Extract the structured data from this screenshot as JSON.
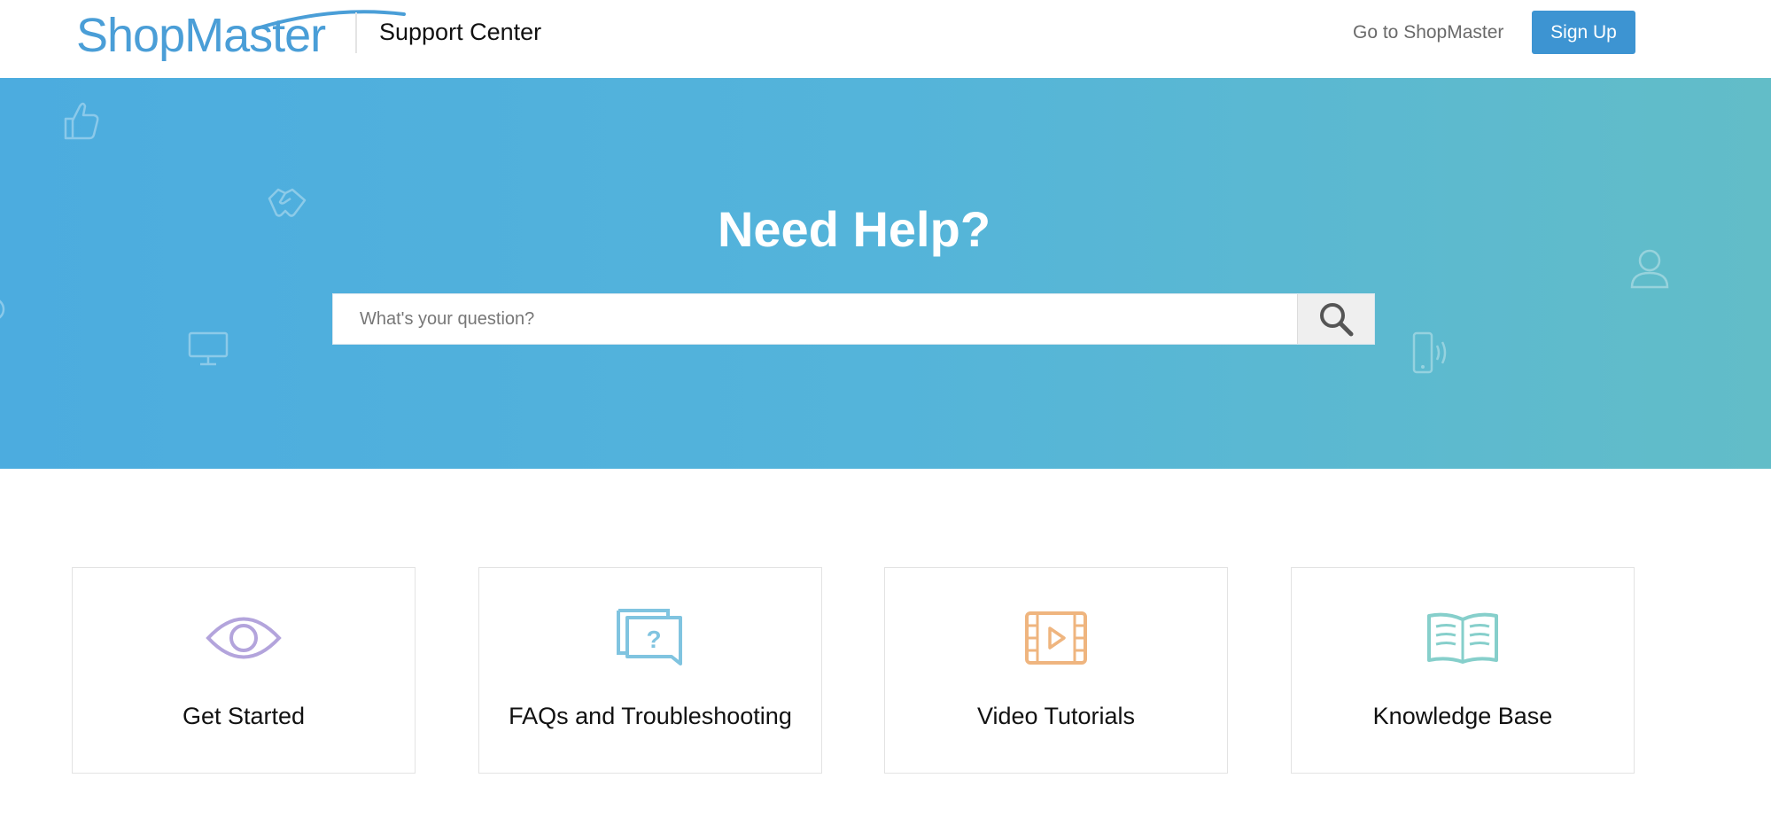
{
  "header": {
    "logo_text": "ShopMaster",
    "title": "Support Center",
    "nav_link": "Go to ShopMaster",
    "signup_label": "Sign Up"
  },
  "hero": {
    "title": "Need Help?",
    "search": {
      "placeholder": "What's your question?",
      "value": "",
      "button_icon": "search-icon"
    },
    "decorative_icons": [
      "thumbs-up-icon",
      "handshake-icon",
      "monitor-icon",
      "user-icon",
      "phone-vibrate-icon",
      "cog-icon"
    ]
  },
  "cards": [
    {
      "label": "Get Started",
      "icon": "eye-icon",
      "color": "#b3a4dc"
    },
    {
      "label": "FAQs and Troubleshooting",
      "icon": "question-chat-icon",
      "color": "#80c4e0"
    },
    {
      "label": "Video Tutorials",
      "icon": "film-play-icon",
      "color": "#efb57f"
    },
    {
      "label": "Knowledge Base",
      "icon": "open-book-icon",
      "color": "#86cfcb"
    }
  ],
  "colors": {
    "accent": "#3d94d2",
    "hero_start": "#4cacdf",
    "hero_end": "#62bdc8"
  }
}
